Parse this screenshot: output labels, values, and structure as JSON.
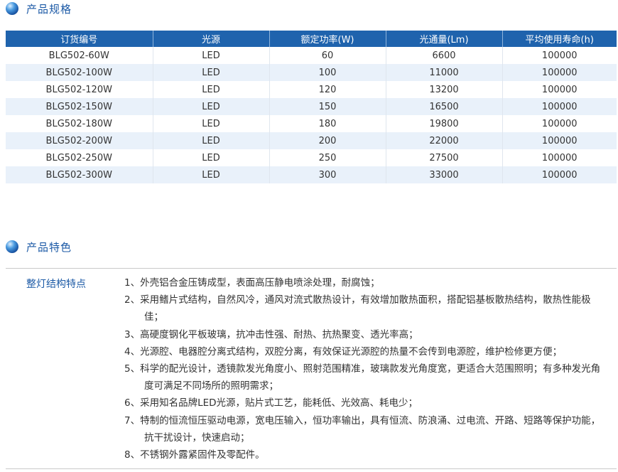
{
  "spec_section": {
    "title": "产品规格",
    "columns": [
      "订货编号",
      "光源",
      "额定功率(W)",
      "光通量(Lm)",
      "平均使用寿命(h)"
    ],
    "rows": [
      [
        "BLG502-60W",
        "LED",
        "60",
        "6600",
        "100000"
      ],
      [
        "BLG502-100W",
        "LED",
        "100",
        "11000",
        "100000"
      ],
      [
        "BLG502-120W",
        "LED",
        "120",
        "13200",
        "100000"
      ],
      [
        "BLG502-150W",
        "LED",
        "150",
        "16500",
        "100000"
      ],
      [
        "BLG502-180W",
        "LED",
        "180",
        "19800",
        "100000"
      ],
      [
        "BLG502-200W",
        "LED",
        "200",
        "22000",
        "100000"
      ],
      [
        "BLG502-250W",
        "LED",
        "250",
        "27500",
        "100000"
      ],
      [
        "BLG502-300W",
        "LED",
        "300",
        "33000",
        "100000"
      ]
    ]
  },
  "features_section": {
    "title": "产品特色",
    "label": "整灯结构特点",
    "items": [
      "1、外壳铝合金压铸成型，表面高压静电喷涂处理，耐腐蚀；",
      "2、采用鳍片式结构，自然风冷，通风对流式散热设计，有效增加散热面积，搭配铝基板散热结构，散热性能极佳；",
      "3、高硬度钢化平板玻璃，抗冲击性强、耐热、抗热聚变、透光率高；",
      "4、光源腔、电器腔分离式结构，双腔分离，有效保证光源腔的热量不会传到电源腔，维护检修更方便；",
      "5、科学的配光设计，透镜款发光角度小、照射范围精准，玻璃款发光角度宽，更适合大范围照明；有多种发光角度可满足不同场所的照明需求；",
      "6、采用知名品牌LED光源，贴片式工艺，能耗低、光效高、耗电少；",
      "7、特制的恒流恒压驱动电源，宽电压输入，恒功率输出，具有恒流、防浪涌、过电流、开路、短路等保护功能，抗干扰设计，快速启动；",
      "8、不锈钢外露紧固件及零配件。"
    ]
  },
  "colors": {
    "accent": "#1c5aa6",
    "header_bg": "#1f63ad",
    "stripe_bg": "#e9f1fa"
  },
  "icons": {
    "section_marker": "globe-icon"
  }
}
